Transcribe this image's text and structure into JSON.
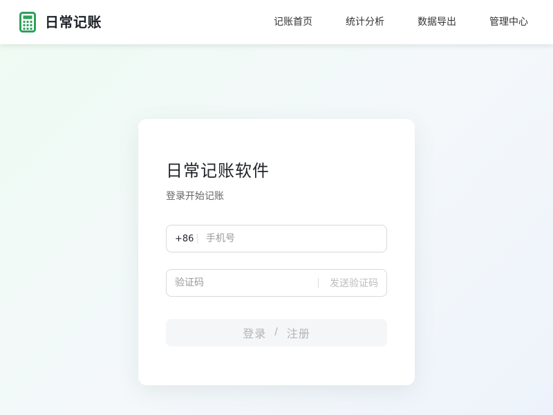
{
  "header": {
    "brand_name": "日常记账",
    "brand_icon": "calculator-icon",
    "brand_color": "#2ea05a",
    "nav": [
      {
        "label": "记账首页"
      },
      {
        "label": "统计分析"
      },
      {
        "label": "数据导出"
      },
      {
        "label": "管理中心"
      }
    ]
  },
  "login": {
    "title": "日常记账软件",
    "subtitle": "登录开始记账",
    "phone": {
      "prefix": "+86",
      "placeholder": "手机号",
      "value": ""
    },
    "code": {
      "placeholder": "验证码",
      "value": "",
      "send_label": "发送验证码"
    },
    "submit": {
      "login_label": "登录",
      "separator": "/",
      "register_label": "注册"
    }
  }
}
